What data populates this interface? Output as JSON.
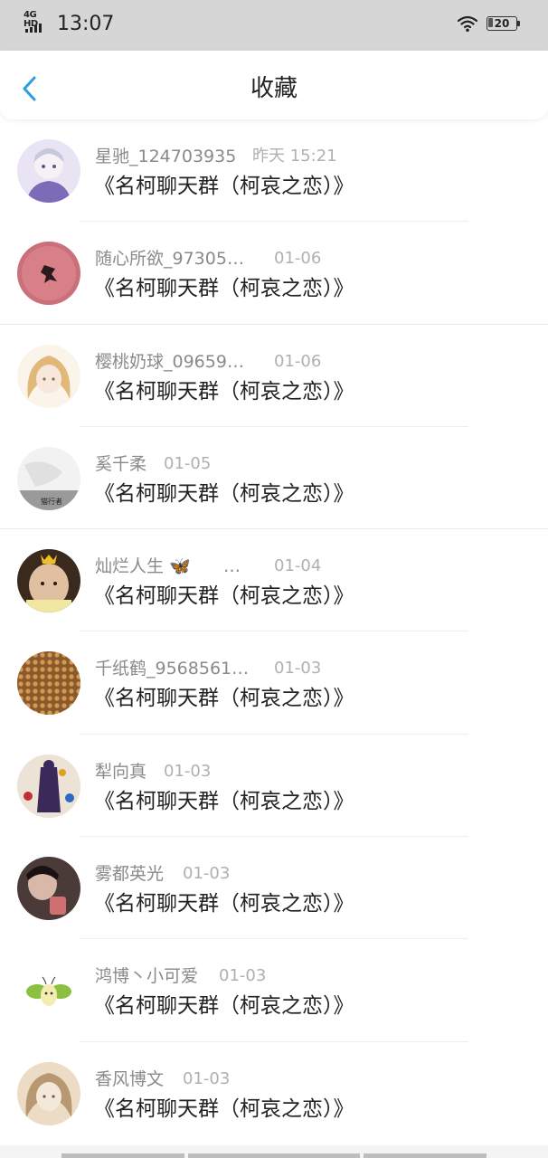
{
  "status_bar": {
    "network": "4G HD",
    "time": "13:07",
    "battery": "20"
  },
  "header": {
    "title": "收藏"
  },
  "items": [
    {
      "name": "星驰_124703935",
      "date": "昨天 15:21",
      "title": "《名柯聊天群（柯哀之恋）》",
      "avatar_colors": [
        "#e8e4f4",
        "#7b6bb8"
      ]
    },
    {
      "name": "随心所欲_97305…",
      "date": "01-06",
      "title": "《名柯聊天群（柯哀之恋）》",
      "avatar_colors": [
        "#c9707a",
        "#2a1a1e"
      ]
    },
    {
      "name": "樱桃奶球_09659…",
      "date": "01-06",
      "title": "《名柯聊天群（柯哀之恋）》",
      "avatar_colors": [
        "#f6e6cf",
        "#e2b77a"
      ]
    },
    {
      "name": "奚千柔",
      "date": "01-05",
      "title": "《名柯聊天群（柯哀之恋）》",
      "avatar_colors": [
        "#f0f0f0",
        "#9a9a9a"
      ]
    },
    {
      "name": "灿烂人生 🦋",
      "date": "01-04",
      "title": "《名柯聊天群（柯哀之恋）》",
      "avatar_colors": [
        "#d9b79a",
        "#3a2a1e"
      ],
      "name_suffix": "…"
    },
    {
      "name": "千纸鹤_9568561…",
      "date": "01-03",
      "title": "《名柯聊天群（柯哀之恋）》",
      "avatar_colors": [
        "#8a5a2e",
        "#d49a50"
      ]
    },
    {
      "name": "犁向真",
      "date": "01-03",
      "title": "《名柯聊天群（柯哀之恋）》",
      "avatar_colors": [
        "#e8dcd0",
        "#3a2a5a"
      ]
    },
    {
      "name": "雾都英光",
      "date": "01-03",
      "title": "《名柯聊天群（柯哀之恋）》",
      "avatar_colors": [
        "#5a4a48",
        "#d07070"
      ]
    },
    {
      "name": "鸿博丶小可爱",
      "date": "01-03",
      "title": "《名柯聊天群（柯哀之恋）》",
      "avatar_colors": [
        "#ffffff",
        "#8cc040"
      ]
    },
    {
      "name": "香风博文",
      "date": "01-03",
      "title": "《名柯聊天群（柯哀之恋）》",
      "avatar_colors": [
        "#ecdcc6",
        "#b89870"
      ]
    }
  ],
  "colors": {
    "accent": "#2f9be6",
    "name_text": "#8a8a8a",
    "date_text": "#b0b0b0",
    "title_text": "#222222",
    "status_bar_bg": "#d6d6d6"
  }
}
